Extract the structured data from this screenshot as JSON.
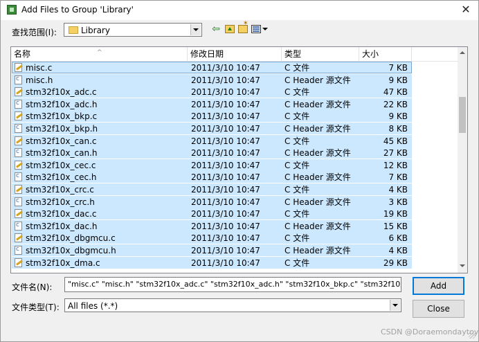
{
  "window": {
    "title": "Add Files to Group 'Library'",
    "close_glyph": "✕"
  },
  "lookin": {
    "label": "查找范围(I):",
    "value": "Library"
  },
  "toolbar": {
    "back_glyph": "⇦"
  },
  "columns": {
    "name": "名称",
    "date": "修改日期",
    "type": "类型",
    "size": "大小",
    "sort_glyph": "^"
  },
  "files": [
    {
      "name": "misc.c",
      "date": "2011/3/10 10:47",
      "type": "C 文件",
      "size": "7 KB",
      "kind": "c"
    },
    {
      "name": "misc.h",
      "date": "2011/3/10 10:47",
      "type": "C Header 源文件",
      "size": "9 KB",
      "kind": "h"
    },
    {
      "name": "stm32f10x_adc.c",
      "date": "2011/3/10 10:47",
      "type": "C 文件",
      "size": "47 KB",
      "kind": "c"
    },
    {
      "name": "stm32f10x_adc.h",
      "date": "2011/3/10 10:47",
      "type": "C Header 源文件",
      "size": "22 KB",
      "kind": "h"
    },
    {
      "name": "stm32f10x_bkp.c",
      "date": "2011/3/10 10:47",
      "type": "C 文件",
      "size": "9 KB",
      "kind": "c"
    },
    {
      "name": "stm32f10x_bkp.h",
      "date": "2011/3/10 10:47",
      "type": "C Header 源文件",
      "size": "8 KB",
      "kind": "h"
    },
    {
      "name": "stm32f10x_can.c",
      "date": "2011/3/10 10:47",
      "type": "C 文件",
      "size": "45 KB",
      "kind": "c"
    },
    {
      "name": "stm32f10x_can.h",
      "date": "2011/3/10 10:47",
      "type": "C Header 源文件",
      "size": "27 KB",
      "kind": "h"
    },
    {
      "name": "stm32f10x_cec.c",
      "date": "2011/3/10 10:47",
      "type": "C 文件",
      "size": "12 KB",
      "kind": "c"
    },
    {
      "name": "stm32f10x_cec.h",
      "date": "2011/3/10 10:47",
      "type": "C Header 源文件",
      "size": "7 KB",
      "kind": "h"
    },
    {
      "name": "stm32f10x_crc.c",
      "date": "2011/3/10 10:47",
      "type": "C 文件",
      "size": "4 KB",
      "kind": "c"
    },
    {
      "name": "stm32f10x_crc.h",
      "date": "2011/3/10 10:47",
      "type": "C Header 源文件",
      "size": "3 KB",
      "kind": "h"
    },
    {
      "name": "stm32f10x_dac.c",
      "date": "2011/3/10 10:47",
      "type": "C 文件",
      "size": "19 KB",
      "kind": "c"
    },
    {
      "name": "stm32f10x_dac.h",
      "date": "2011/3/10 10:47",
      "type": "C Header 源文件",
      "size": "15 KB",
      "kind": "h"
    },
    {
      "name": "stm32f10x_dbgmcu.c",
      "date": "2011/3/10 10:47",
      "type": "C 文件",
      "size": "6 KB",
      "kind": "c"
    },
    {
      "name": "stm32f10x_dbgmcu.h",
      "date": "2011/3/10 10:47",
      "type": "C Header 源文件",
      "size": "4 KB",
      "kind": "h"
    },
    {
      "name": "stm32f10x_dma.c",
      "date": "2011/3/10 10:47",
      "type": "C 文件",
      "size": "29 KB",
      "kind": "c"
    }
  ],
  "filename": {
    "label": "文件名(N):",
    "value": "\"misc.c\" \"misc.h\" \"stm32f10x_adc.c\" \"stm32f10x_adc.h\" \"stm32f10x_bkp.c\" \"stm32f10x_bkp.h\" \"stm32"
  },
  "filetype": {
    "label": "文件类型(T):",
    "value": "All files (*.*)"
  },
  "buttons": {
    "add": "Add",
    "close": "Close"
  },
  "watermark": "CSDN @Doraemondaytoy",
  "colors": {
    "selection": "#cce8ff",
    "default_button_border": "#0078d7"
  }
}
